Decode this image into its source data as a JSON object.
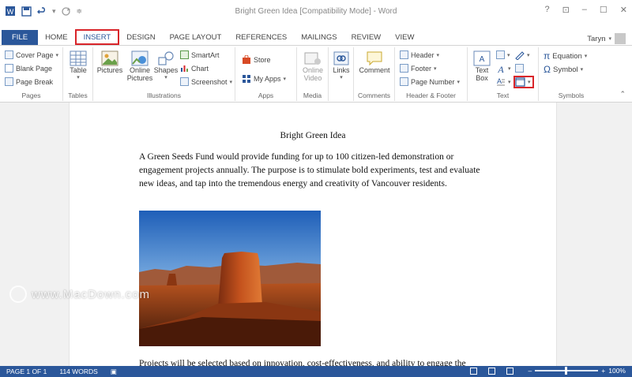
{
  "window": {
    "title": "Bright Green Idea [Compatibility Mode] - Word",
    "controls": [
      "?",
      "⊡",
      "–",
      "☐",
      "✕"
    ]
  },
  "quick_access": [
    "save-icon",
    "undo-icon",
    "redo-icon",
    "customize-icon"
  ],
  "tabs": [
    {
      "label": "FILE"
    },
    {
      "label": "HOME"
    },
    {
      "label": "INSERT",
      "active": true
    },
    {
      "label": "DESIGN"
    },
    {
      "label": "PAGE LAYOUT"
    },
    {
      "label": "REFERENCES"
    },
    {
      "label": "MAILINGS"
    },
    {
      "label": "REVIEW"
    },
    {
      "label": "VIEW"
    }
  ],
  "user": {
    "name": "Taryn"
  },
  "ribbon": {
    "pages": {
      "label": "Pages",
      "items": [
        "Cover Page",
        "Blank Page",
        "Page Break"
      ]
    },
    "tables": {
      "label": "Tables",
      "table": "Table"
    },
    "illustrations": {
      "label": "Illustrations",
      "pictures": "Pictures",
      "online_pictures_1": "Online",
      "online_pictures_2": "Pictures",
      "shapes": "Shapes",
      "smartart": "SmartArt",
      "chart": "Chart",
      "screenshot": "Screenshot"
    },
    "apps": {
      "label": "Apps",
      "store": "Store",
      "my_apps": "My Apps"
    },
    "media": {
      "label": "Media",
      "online_video_1": "Online",
      "online_video_2": "Video"
    },
    "links": {
      "label": "",
      "links": "Links"
    },
    "comments": {
      "label": "Comments",
      "comment": "Comment"
    },
    "header_footer": {
      "label": "Header & Footer",
      "header": "Header",
      "footer": "Footer",
      "page_number": "Page Number"
    },
    "text": {
      "label": "Text",
      "text_box_1": "Text",
      "text_box_2": "Box"
    },
    "symbols": {
      "label": "Symbols",
      "equation": "Equation",
      "symbol": "Symbol"
    }
  },
  "document": {
    "title": "Bright Green Idea",
    "paragraph1": "A Green Seeds Fund would provide funding for up to 100 citizen-led demonstration or engagement projects annually. The purpose is to stimulate bold experiments, test and evaluate new ideas, and tap into the tremendous energy and creativity of Vancouver residents.",
    "paragraph2": "Projects will be selected based on innovation, cost-effectiveness, and ability to engage the"
  },
  "watermark": "www.MacDown.com",
  "status": {
    "page": "PAGE 1 OF 1",
    "words": "114 WORDS",
    "zoom": "100%"
  }
}
